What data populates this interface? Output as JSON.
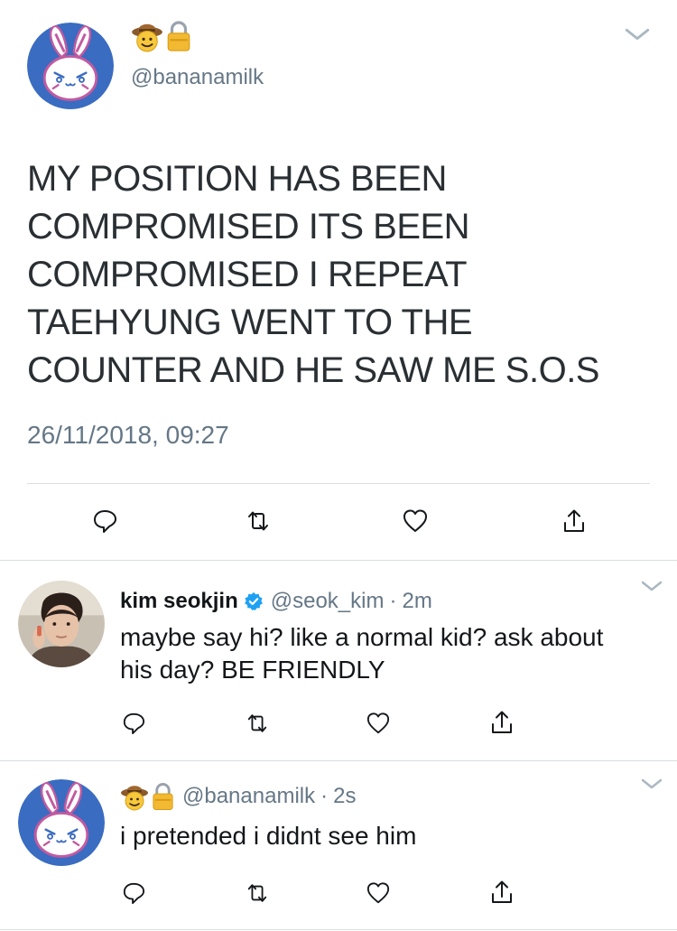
{
  "main_tweet": {
    "handle": "@bananamilk",
    "text_lines": [
      "MY POSITION HAS BEEN",
      "COMPROMISED ITS BEEN",
      "COMPROMISED I REPEAT",
      "TAEHYUNG WENT TO THE",
      "COUNTER AND HE SAW ME S.O.S"
    ],
    "timestamp": "26/11/2018, 09:27",
    "emojis": [
      "cowboy-face-icon",
      "lock-icon"
    ],
    "actions": [
      "reply-icon",
      "retweet-icon",
      "like-icon",
      "share-icon"
    ]
  },
  "replies": [
    {
      "name": "kim seokjin",
      "verified": true,
      "handle": "@seok_kim",
      "separator": "·",
      "time": "2m",
      "text_lines": [
        "maybe say hi? like a normal kid? ask about",
        "his day? BE FRIENDLY"
      ]
    },
    {
      "emojis": [
        "cowboy-face-icon",
        "lock-icon"
      ],
      "handle": "@bananamilk",
      "separator": "·",
      "time": "2s",
      "text_lines": [
        "i pretended i didnt see him"
      ]
    }
  ],
  "colors": {
    "text": "#14171a",
    "secondary": "#657786",
    "divider": "#d9dee2",
    "verified": "#1da1f2",
    "avatar_blue": "#3a6cc1",
    "avatar_pink": "#c25aa0"
  }
}
